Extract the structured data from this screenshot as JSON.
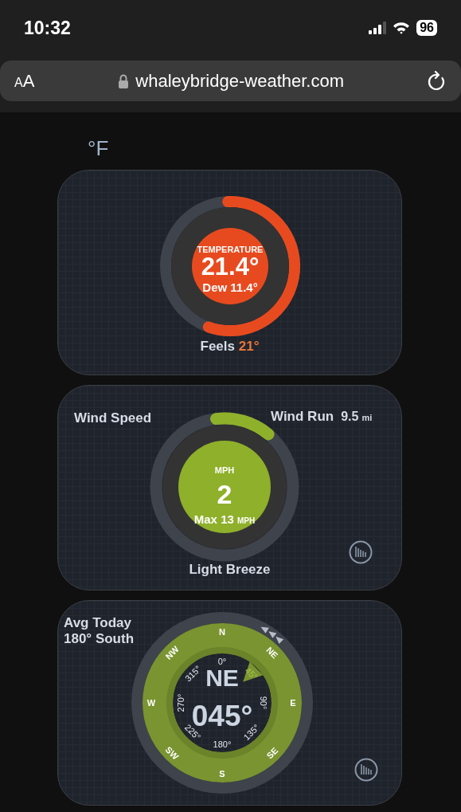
{
  "status_bar": {
    "time": "10:32",
    "battery": "96"
  },
  "browser": {
    "text_size_button": "AA",
    "url": "whaleybridge-weather.com"
  },
  "unit_toggle": "°F",
  "temperature": {
    "label": "TEMPERATURE",
    "value": "21.4°",
    "dew": "Dew 11.4°",
    "feels_label": "Feels",
    "feels_value": "21°",
    "level": 0.56
  },
  "wind": {
    "title": "Wind Speed",
    "run_label": "Wind Run",
    "run_value": "9.5",
    "run_unit": "mi",
    "unit": "MPH",
    "speed": "2",
    "max": "Max 13",
    "max_unit": "MPH",
    "description": "Light Breeze",
    "level": 0.13
  },
  "direction": {
    "avg_label": "Avg Today",
    "avg_value": "180° South",
    "cardinals": [
      "N",
      "NE",
      "E",
      "SE",
      "S",
      "SW",
      "W",
      "NW"
    ],
    "degrees": [
      {
        "label": "0°",
        "selected": false
      },
      {
        "label": "45°",
        "selected": true
      },
      {
        "label": "90°",
        "selected": false
      },
      {
        "label": "135°",
        "selected": false
      },
      {
        "label": "180°",
        "selected": false
      },
      {
        "label": "225°",
        "selected": false
      },
      {
        "label": "270°",
        "selected": false
      },
      {
        "label": "315°",
        "selected": false
      }
    ],
    "heading": "NE",
    "bearing": "045°"
  }
}
